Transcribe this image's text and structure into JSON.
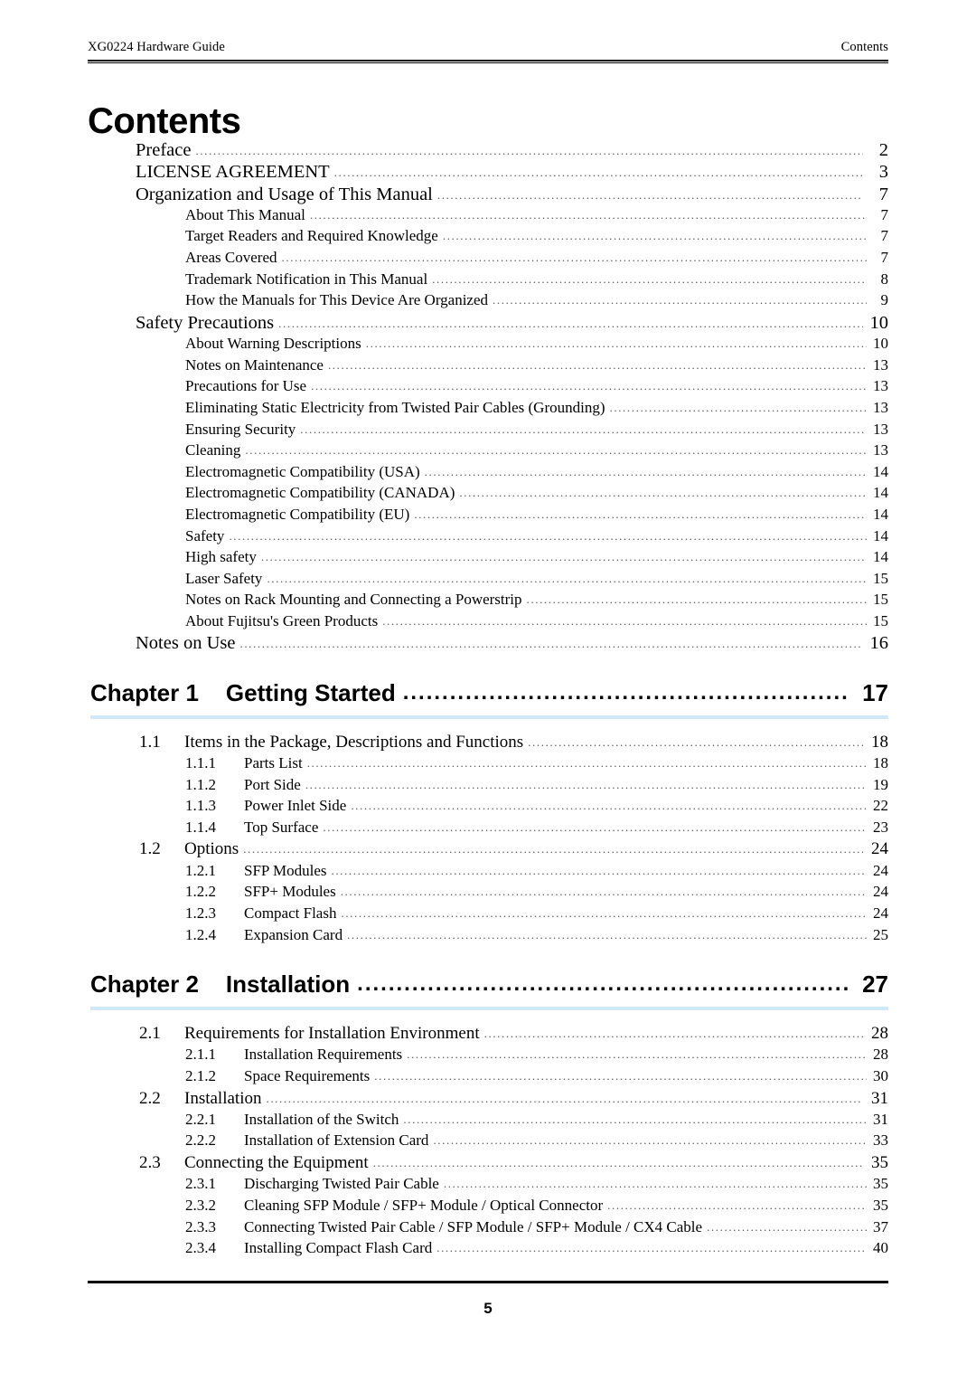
{
  "header": {
    "left": "XG0224 Hardware Guide",
    "right": "Contents"
  },
  "title": "Contents",
  "front_matter": [
    {
      "level": 1,
      "label": "Preface",
      "page": "2"
    },
    {
      "level": 1,
      "label": "LICENSE AGREEMENT",
      "page": "3"
    },
    {
      "level": 1,
      "label": "Organization and Usage of This Manual",
      "page": "7"
    },
    {
      "level": 2,
      "label": "About This Manual",
      "page": "7"
    },
    {
      "level": 2,
      "label": "Target Readers and Required Knowledge",
      "page": "7"
    },
    {
      "level": 2,
      "label": "Areas Covered",
      "page": "7"
    },
    {
      "level": 2,
      "label": "Trademark Notification in This Manual",
      "page": "8"
    },
    {
      "level": 2,
      "label": "How the Manuals for This Device Are Organized",
      "page": "9"
    },
    {
      "level": 1,
      "label": "Safety Precautions",
      "page": "10"
    },
    {
      "level": 2,
      "label": "About Warning Descriptions",
      "page": "10"
    },
    {
      "level": 2,
      "label": "Notes on Maintenance",
      "page": "13"
    },
    {
      "level": 2,
      "label": "Precautions for Use",
      "page": "13"
    },
    {
      "level": 2,
      "label": "Eliminating Static Electricity from Twisted Pair Cables (Grounding)",
      "page": "13"
    },
    {
      "level": 2,
      "label": "Ensuring Security",
      "page": "13"
    },
    {
      "level": 2,
      "label": "Cleaning",
      "page": "13"
    },
    {
      "level": 2,
      "label": "Electromagnetic Compatibility (USA)",
      "page": "14"
    },
    {
      "level": 2,
      "label": "Electromagnetic Compatibility (CANADA)",
      "page": "14"
    },
    {
      "level": 2,
      "label": "Electromagnetic Compatibility (EU)",
      "page": "14"
    },
    {
      "level": 2,
      "label": "Safety",
      "page": "14"
    },
    {
      "level": 2,
      "label": "High safety",
      "page": "14"
    },
    {
      "level": 2,
      "label": "Laser Safety",
      "page": "15"
    },
    {
      "level": 2,
      "label": "Notes on Rack Mounting and Connecting a Powerstrip",
      "page": "15"
    },
    {
      "level": 2,
      "label": "About Fujitsu's Green Products",
      "page": "15"
    },
    {
      "level": 1,
      "label": "Notes on Use",
      "page": "16"
    }
  ],
  "chapters": [
    {
      "number": "Chapter 1",
      "title": "Getting Started",
      "page": "17",
      "entries": [
        {
          "level": "sec",
          "num": "1.1",
          "label": "Items in the Package, Descriptions and Functions",
          "page": "18"
        },
        {
          "level": "subsec",
          "num": "1.1.1",
          "label": "Parts List",
          "page": "18"
        },
        {
          "level": "subsec",
          "num": "1.1.2",
          "label": "Port Side",
          "page": "19"
        },
        {
          "level": "subsec",
          "num": "1.1.3",
          "label": "Power Inlet Side",
          "page": "22"
        },
        {
          "level": "subsec",
          "num": "1.1.4",
          "label": "Top Surface",
          "page": "23"
        },
        {
          "level": "sec",
          "num": "1.2",
          "label": "Options",
          "page": "24"
        },
        {
          "level": "subsec",
          "num": "1.2.1",
          "label": "SFP Modules",
          "page": "24"
        },
        {
          "level": "subsec",
          "num": "1.2.2",
          "label": "SFP+ Modules",
          "page": "24"
        },
        {
          "level": "subsec",
          "num": "1.2.3",
          "label": "Compact Flash",
          "page": "24"
        },
        {
          "level": "subsec",
          "num": "1.2.4",
          "label": "Expansion Card",
          "page": "25"
        }
      ]
    },
    {
      "number": "Chapter 2",
      "title": "Installation",
      "page": "27",
      "entries": [
        {
          "level": "sec",
          "num": "2.1",
          "label": "Requirements for Installation Environment",
          "page": "28"
        },
        {
          "level": "subsec",
          "num": "2.1.1",
          "label": "Installation Requirements",
          "page": "28"
        },
        {
          "level": "subsec",
          "num": "2.1.2",
          "label": "Space Requirements",
          "page": "30"
        },
        {
          "level": "sec",
          "num": "2.2",
          "label": "Installation",
          "page": "31"
        },
        {
          "level": "subsec",
          "num": "2.2.1",
          "label": "Installation of the Switch",
          "page": "31"
        },
        {
          "level": "subsec",
          "num": "2.2.2",
          "label": "Installation of Extension Card",
          "page": "33"
        },
        {
          "level": "sec",
          "num": "2.3",
          "label": "Connecting the Equipment",
          "page": "35"
        },
        {
          "level": "subsec",
          "num": "2.3.1",
          "label": "Discharging Twisted Pair Cable",
          "page": "35"
        },
        {
          "level": "subsec",
          "num": "2.3.2",
          "label": "Cleaning SFP Module / SFP+ Module / Optical Connector",
          "page": "35"
        },
        {
          "level": "subsec",
          "num": "2.3.3",
          "label": "Connecting Twisted Pair Cable / SFP Module / SFP+ Module / CX4 Cable",
          "page": "37"
        },
        {
          "level": "subsec",
          "num": "2.3.4",
          "label": "Installing Compact Flash Card",
          "page": "40"
        }
      ]
    }
  ],
  "footer": {
    "page_number": "5"
  },
  "colors": {
    "chapter_rule": "#cfe9fb",
    "text": "#000000"
  }
}
